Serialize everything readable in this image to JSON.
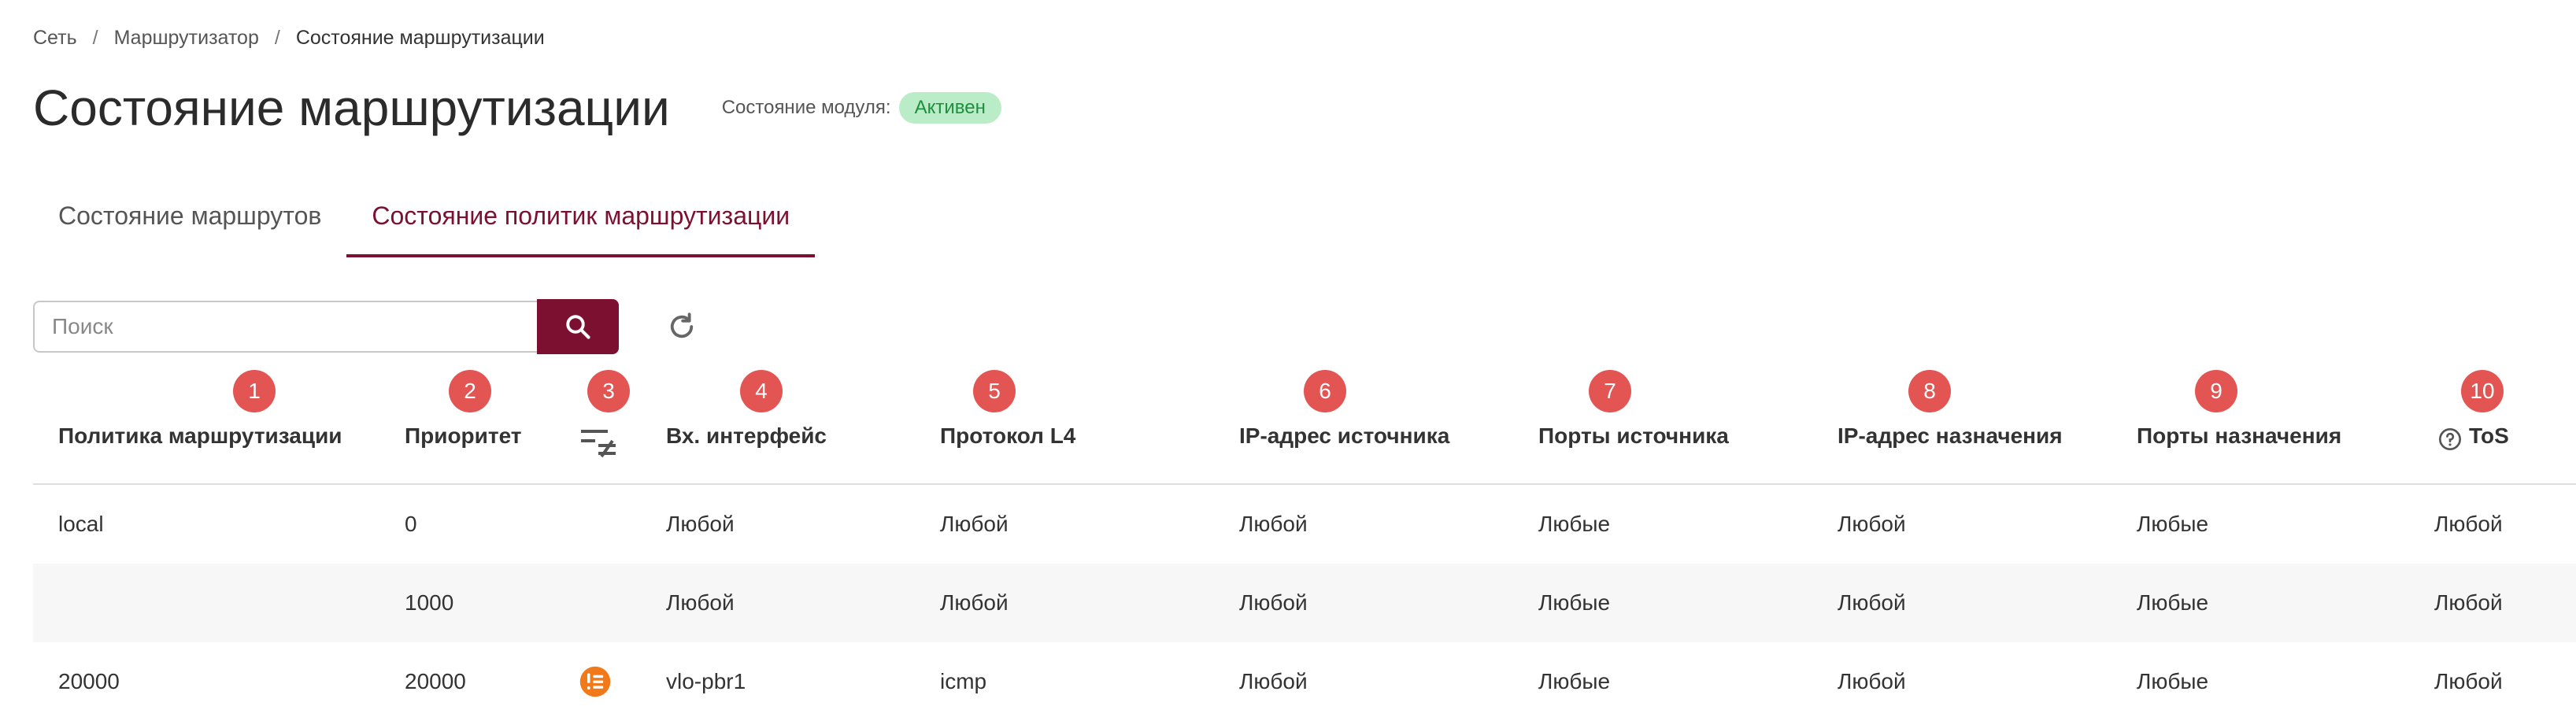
{
  "breadcrumb": {
    "items": [
      "Сеть",
      "Маршрутизатор",
      "Состояние маршрутизации"
    ],
    "separator": "/"
  },
  "header": {
    "title": "Состояние маршрутизации",
    "module_state_label": "Состояние модуля:",
    "module_state_badge": "Активен"
  },
  "tabs": [
    {
      "label": "Состояние маршрутов",
      "active": false
    },
    {
      "label": "Состояние политик маршрутизации",
      "active": true
    }
  ],
  "search": {
    "placeholder": "Поиск",
    "value": ""
  },
  "icons": {
    "search": "search-icon",
    "refresh": "refresh-icon",
    "filter_column": "not-equal-filter-icon",
    "tos_help": "question-circle-icon",
    "row_flag": "list-badge-icon"
  },
  "colors": {
    "accent": "#7c1030",
    "badge_bg": "#b9ecc7",
    "badge_text": "#1f8f3e",
    "marker": "#e25552",
    "row_flag": "#f07a1a"
  },
  "table": {
    "columns": [
      {
        "num": "1",
        "label": "Политика маршрутизации"
      },
      {
        "num": "2",
        "label": "Приоритет"
      },
      {
        "num": "3",
        "label": ""
      },
      {
        "num": "4",
        "label": "Вх. интерфейс"
      },
      {
        "num": "5",
        "label": "Протокол L4"
      },
      {
        "num": "6",
        "label": "IP-адрес источника"
      },
      {
        "num": "7",
        "label": "Порты источника"
      },
      {
        "num": "8",
        "label": "IP-адрес назначения"
      },
      {
        "num": "9",
        "label": "Порты назначения"
      },
      {
        "num": "10",
        "label": "ToS"
      }
    ],
    "rows": [
      {
        "policy": "local",
        "priority": "0",
        "flag": false,
        "in_iface": "Любой",
        "l4": "Любой",
        "src_ip": "Любой",
        "src_ports": "Любые",
        "dst_ip": "Любой",
        "dst_ports": "Любые",
        "tos": "Любой"
      },
      {
        "policy": "",
        "priority": "1000",
        "flag": false,
        "in_iface": "Любой",
        "l4": "Любой",
        "src_ip": "Любой",
        "src_ports": "Любые",
        "dst_ip": "Любой",
        "dst_ports": "Любые",
        "tos": "Любой"
      },
      {
        "policy": "20000",
        "priority": "20000",
        "flag": true,
        "in_iface": "vlo-pbr1",
        "l4": "icmp",
        "src_ip": "Любой",
        "src_ports": "Любые",
        "dst_ip": "Любой",
        "dst_ports": "Любые",
        "tos": "Любой"
      }
    ]
  }
}
